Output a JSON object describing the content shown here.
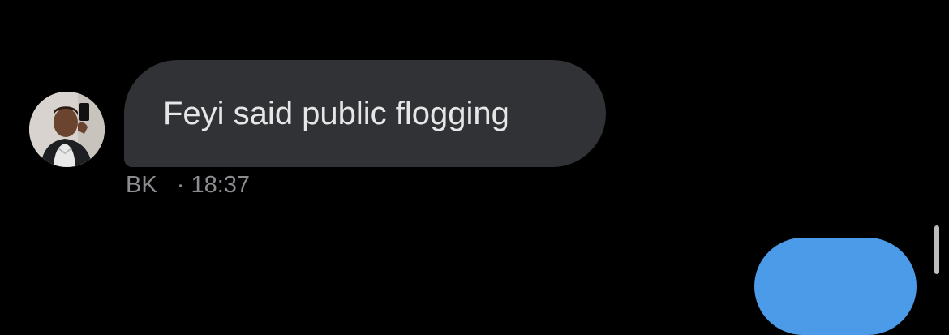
{
  "message": {
    "text": "Feyi said public flogging",
    "sender": "BK",
    "separator": "·",
    "time": "18:37",
    "avatar_icon": "profile-photo-avatar"
  },
  "colors": {
    "background": "#000000",
    "incoming_bubble": "#313235",
    "outgoing_bubble": "#4c9be8",
    "meta_text": "#8c8c91"
  }
}
